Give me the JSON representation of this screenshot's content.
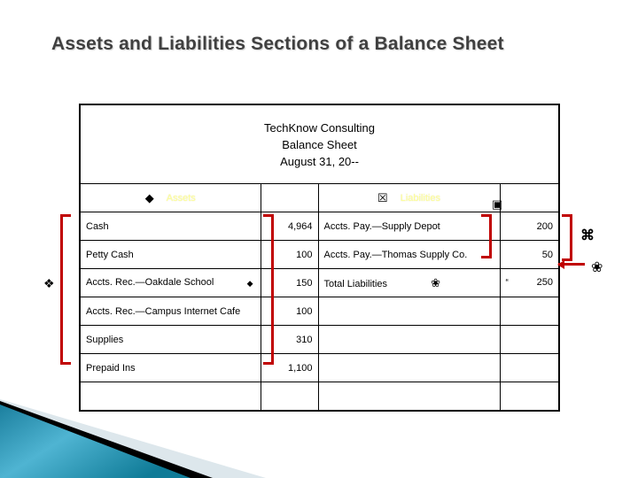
{
  "slide": {
    "title": "Assets and Liabilities Sections of a Balance Sheet",
    "accent_color": "#c00000",
    "label_color": "#ffff99",
    "decor_color": "#2196b5"
  },
  "balance_sheet": {
    "company": "TechKnow Consulting",
    "statement": "Balance Sheet",
    "date": "August 31, 20--",
    "sections": {
      "assets_label": "Assets",
      "assets_icon": "black-diamond-bullet",
      "liabilities_label": "Liabilities",
      "liabilities_icon": "ballot-box-with-x",
      "divider_icon": "boxed-square-marker"
    },
    "assets": [
      {
        "account": "Cash",
        "amount": "4,964"
      },
      {
        "account": "Petty Cash",
        "amount": "100"
      },
      {
        "account": "Accts. Rec.—Oakdale School",
        "amount": "150",
        "row_icon": "small-black-diamond"
      },
      {
        "account": "Accts. Rec.—Campus Internet Cafe",
        "amount": "100"
      },
      {
        "account": "Supplies",
        "amount": "310"
      },
      {
        "account": "Prepaid Ins",
        "amount": "1,100"
      },
      {
        "account": "",
        "amount": ""
      }
    ],
    "liabilities": [
      {
        "account": "Accts. Pay.—Supply Depot",
        "amount": "200"
      },
      {
        "account": "Accts. Pay.—Thomas Supply Co.",
        "amount": "50"
      },
      {
        "account": "Total Liabilities",
        "amount": "250",
        "row_icon": "filled-flower-glyph",
        "amount_icon": "double-quote-mark"
      },
      {
        "account": "",
        "amount": ""
      },
      {
        "account": "",
        "amount": ""
      },
      {
        "account": "",
        "amount": ""
      },
      {
        "account": "",
        "amount": ""
      }
    ]
  },
  "annotations": {
    "assets_bracket": "red-bracket-left",
    "liabilities_bracket": "red-bracket-right",
    "margin_bracket": "red-bracket-right",
    "margin_arrow": "red-left-arrow"
  },
  "decorative_glyphs": {
    "left_margin": "❖",
    "right_command": "⌘",
    "right_flower": "❀"
  }
}
